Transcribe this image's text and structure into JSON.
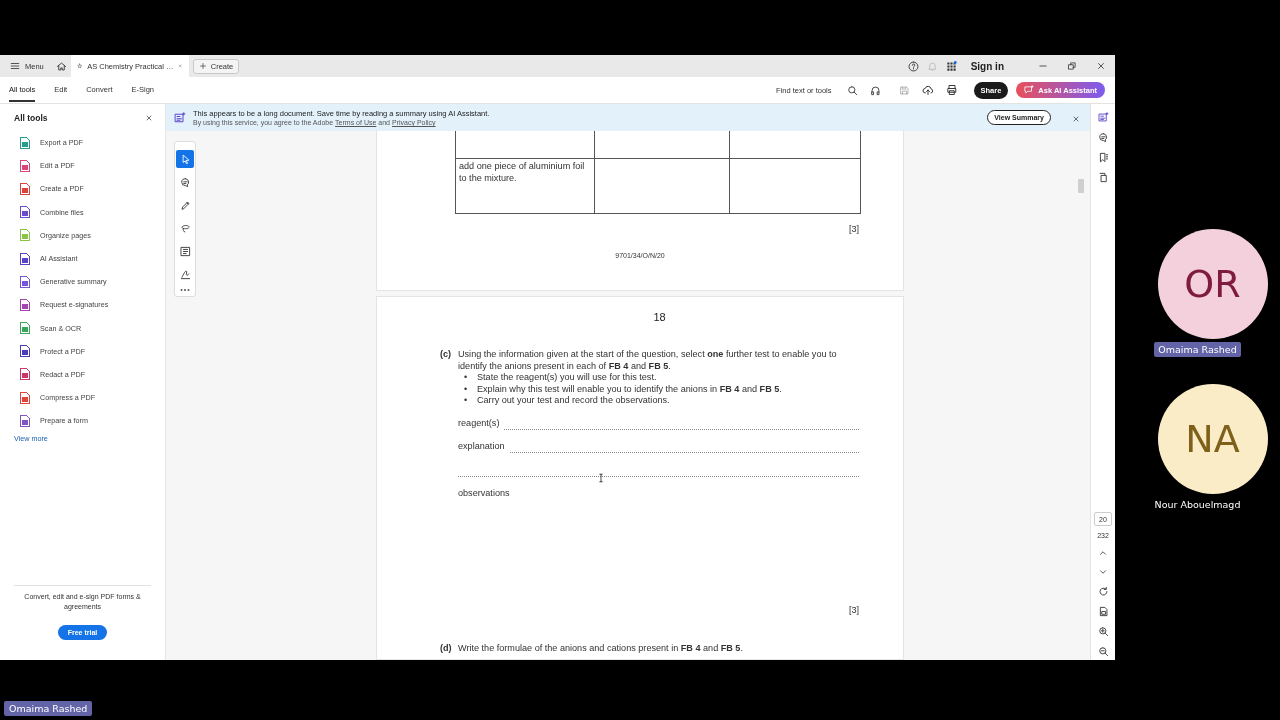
{
  "app_bar": {
    "menu_label": "Menu",
    "document_tab": {
      "title": "AS Chemistry Practical …",
      "selected": true
    },
    "create_label": "Create",
    "sign_in": "Sign in"
  },
  "toolbar": {
    "tabs": [
      {
        "label": "All tools",
        "selected": true
      },
      {
        "label": "Edit",
        "selected": false
      },
      {
        "label": "Convert",
        "selected": false
      },
      {
        "label": "E-Sign",
        "selected": false
      }
    ],
    "find_label": "Find text or tools",
    "share": "Share",
    "ask_ai": "Ask AI Assistant"
  },
  "tools_panel": {
    "title": "All tools",
    "items": [
      {
        "label": "Export a PDF",
        "color": "#2a9d8f"
      },
      {
        "label": "Edit a PDF",
        "color": "#d9467a"
      },
      {
        "label": "Create a PDF",
        "color": "#d9453d"
      },
      {
        "label": "Combine files",
        "color": "#6b4fc8"
      },
      {
        "label": "Organize pages",
        "color": "#8bc34a"
      },
      {
        "label": "AI Assistant",
        "color": "#5a43c9"
      },
      {
        "label": "Generative summary",
        "color": "#7357d6"
      },
      {
        "label": "Request e-signatures",
        "color": "#a445b2"
      },
      {
        "label": "Scan & OCR",
        "color": "#3ba55c"
      },
      {
        "label": "Protect a PDF",
        "color": "#4a3fb8"
      },
      {
        "label": "Redact a PDF",
        "color": "#c8386a"
      },
      {
        "label": "Compress a PDF",
        "color": "#e0453a"
      },
      {
        "label": "Prepare a form",
        "color": "#7e57c2"
      }
    ],
    "view_more": "View more",
    "promo": "Convert, edit and e-sign PDF forms & agreements",
    "trial_button": "Free trial"
  },
  "banner": {
    "message": "This appears to be a long document. Save time by reading a summary using AI Assistant.",
    "fine_print": {
      "before": "By using this service, you agree to the Adobe",
      "terms": "Terms of Use",
      "middle": "and",
      "privacy": "Privacy Policy"
    },
    "view_summary": "View Summary"
  },
  "annotation_tools": [
    {
      "kind": "select",
      "selected": true
    },
    {
      "kind": "comment",
      "selected": false
    },
    {
      "kind": "pen",
      "selected": false
    },
    {
      "kind": "lasso",
      "selected": false
    },
    {
      "kind": "text",
      "selected": false
    },
    {
      "kind": "sign",
      "selected": false
    }
  ],
  "previous_page": {
    "table_rows": [
      {
        "column_1": "add one piece of aluminium foil to the mixture."
      }
    ],
    "marks": "[3]",
    "footer": "9701/34/O/N/20"
  },
  "page": {
    "number": "18",
    "questions": [
      {
        "label": "(c)",
        "text": "Using the information given at the start of the question, select **one** further test to enable you to identify the anions present in each of **FB 4** and **FB 5**.",
        "bullets": [
          {
            "marker": "•",
            "text": "State the reagent(s) you will use for this test."
          },
          {
            "marker": "•",
            "text": "Explain why this test will enable you to identify the anions in **FB 4** and **FB 5**."
          },
          {
            "marker": "•",
            "text": "Carry out your test and record the observations."
          }
        ],
        "answer_lines": [
          {
            "kind": "labelled",
            "label": "reagent(s)"
          },
          {
            "kind": "labelled",
            "label": "explanation"
          },
          {
            "kind": "continuation"
          }
        ],
        "observations": "observations",
        "marks": "[3]"
      },
      {
        "label": "(d)",
        "text": "Write the formulae of the anions and cations present in **FB 4** and **FB 5**."
      }
    ]
  },
  "page_navigation": {
    "current_page": "20",
    "page_count": "232"
  },
  "participants": [
    {
      "initials": "OR",
      "name": "Omaima Rashed",
      "color": "#f3d0dc",
      "speaking": true
    },
    {
      "initials": "NA",
      "name": "Nour Abouelmagd",
      "color": "#fbecc8",
      "speaking": false
    }
  ],
  "presenter_label": "Omaima Rashed"
}
